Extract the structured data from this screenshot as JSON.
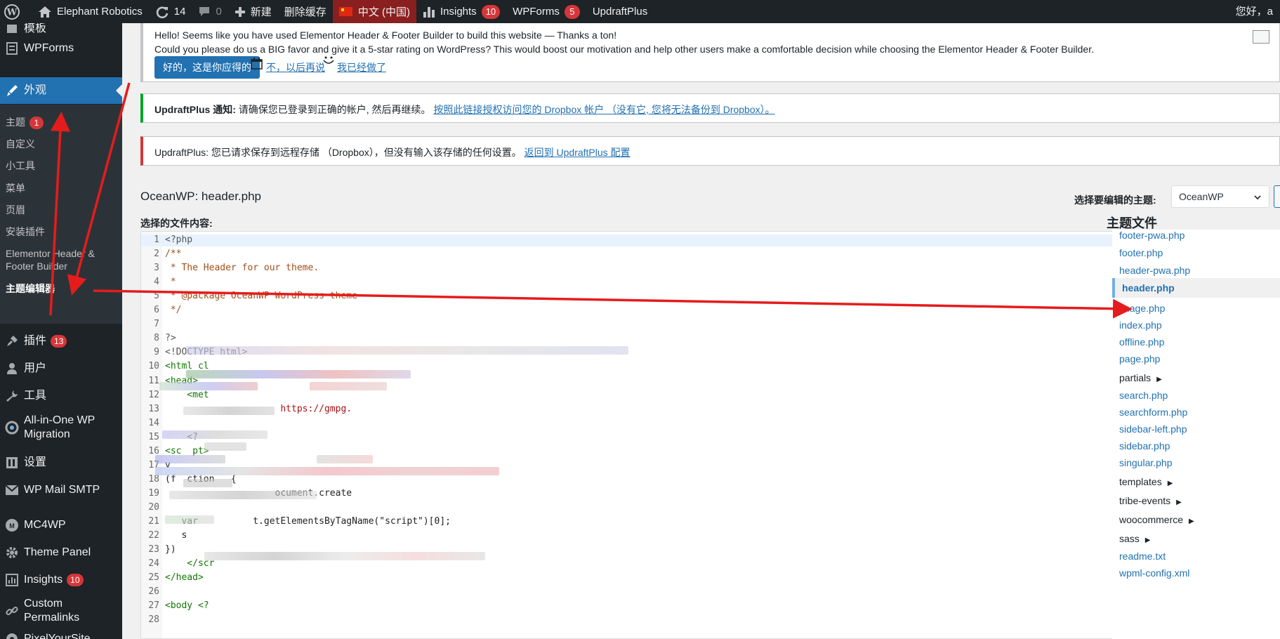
{
  "admin_bar": {
    "site_name": "Elephant Robotics",
    "updates_count": "14",
    "comments_count": "0",
    "new_label": "新建",
    "purge_cache_label": "删除缓存",
    "language_label": "中文 (中国)",
    "insights_label": "Insights",
    "insights_count": "10",
    "wpforms_label": "WPForms",
    "wpforms_count": "5",
    "updraftplus_label": "UpdraftPlus",
    "greeting": "您好，a"
  },
  "sidebar": {
    "items": [
      {
        "label": "模板",
        "icon": "templates-icon"
      },
      {
        "label": "WPForms",
        "icon": "wpforms-icon"
      },
      {
        "label": "外观",
        "icon": "appearance-icon",
        "active": true
      },
      {
        "label": "插件",
        "icon": "plugins-icon",
        "badge": "13"
      },
      {
        "label": "用户",
        "icon": "users-icon"
      },
      {
        "label": "工具",
        "icon": "tools-icon"
      },
      {
        "label": "All-in-One WP Migration",
        "icon": "migration-icon"
      },
      {
        "label": "设置",
        "icon": "settings-icon"
      },
      {
        "label": "WP Mail SMTP",
        "icon": "mail-icon"
      },
      {
        "label": "MC4WP",
        "icon": "mc4wp-icon"
      },
      {
        "label": "Theme Panel",
        "icon": "gear-icon"
      },
      {
        "label": "Insights",
        "icon": "insights-icon",
        "badge": "10"
      },
      {
        "label": "Custom Permalinks",
        "icon": "link-icon"
      },
      {
        "label": "PixelYourSite",
        "icon": "pixelyoursite-icon"
      }
    ],
    "submenu": [
      {
        "label": "主题",
        "badge": "1"
      },
      {
        "label": "自定义"
      },
      {
        "label": "小工具"
      },
      {
        "label": "菜单"
      },
      {
        "label": "页眉"
      },
      {
        "label": "安装插件"
      },
      {
        "label": "Elementor Header & Footer Builder"
      },
      {
        "label": "主题编辑器",
        "current": true
      }
    ]
  },
  "hfe_notice": {
    "line1": "Hello! Seems like you have used Elementor Header & Footer Builder to build this website — Thanks a ton!",
    "line2": "Could you please do us a BIG favor and give it a 5-star rating on WordPress? This would boost our motivation and help other users make a comfortable decision while choosing the Elementor Header & Footer Builder.",
    "rate_button": "好的，这是你应得的",
    "later_link": "不，以后再说",
    "done_link": "我已经做了"
  },
  "updraft_notice_1": {
    "label": "UpdraftPlus 通知:",
    "text": " 请确保您已登录到正确的帐户, 然后再继续。",
    "link": "按照此链接授权访问您的 Dropbox 帐户 （没有它, 您将无法备份到 Dropbox）。"
  },
  "updraft_notice_2": {
    "text": "UpdraftPlus: 您已请求保存到远程存储 （Dropbox），但没有输入该存储的任何设置。",
    "link": "返回到 UpdraftPlus 配置"
  },
  "editor": {
    "file_title": "OceanWP: header.php",
    "select_theme_label": "选择要编辑的主题:",
    "selected_theme": "OceanWP",
    "content_label": "选择的文件内容:",
    "lines": [
      {
        "n": "1",
        "text": "<?php",
        "cls": "c-meta"
      },
      {
        "n": "2",
        "text": "/**",
        "cls": "c-comment"
      },
      {
        "n": "3",
        "text": " * The Header for our theme.",
        "cls": "c-comment"
      },
      {
        "n": "4",
        "text": " *",
        "cls": "c-comment"
      },
      {
        "n": "5",
        "text": " * @package OceanWP WordPress theme",
        "cls": "c-comment"
      },
      {
        "n": "6",
        "text": " */",
        "cls": "c-comment"
      },
      {
        "n": "7",
        "text": "",
        "cls": "c-plain"
      },
      {
        "n": "8",
        "text": "?>",
        "cls": "c-meta"
      },
      {
        "n": "9",
        "text": "<!DOCTYPE html>",
        "cls": "c-meta"
      },
      {
        "n": "10",
        "text": "<html cl",
        "cls": "c-tag"
      },
      {
        "n": "11",
        "text": "<head>",
        "cls": "c-tag"
      },
      {
        "n": "12",
        "text": "    <met",
        "cls": "c-tag"
      },
      {
        "n": "13",
        "text": "                     https://gmpg.",
        "cls": "c-str"
      },
      {
        "n": "14",
        "text": "",
        "cls": "c-plain"
      },
      {
        "n": "15",
        "text": "    <?",
        "cls": "c-meta"
      },
      {
        "n": "16",
        "text": "<sc  pt>",
        "cls": "c-tag"
      },
      {
        "n": "17",
        "text": "v",
        "cls": "c-plain"
      },
      {
        "n": "18",
        "text": "(f  ction   {",
        "cls": "c-plain"
      },
      {
        "n": "19",
        "text": "                    ocument.create",
        "cls": "c-plain"
      },
      {
        "n": "20",
        "text": "",
        "cls": "c-plain"
      },
      {
        "n": "21",
        "text": "   var          t.getElementsByTagName(\"script\")[0];",
        "cls": "c-plain"
      },
      {
        "n": "22",
        "text": "   s",
        "cls": "c-plain"
      },
      {
        "n": "23",
        "text": "})",
        "cls": "c-plain"
      },
      {
        "n": "24",
        "text": "    </scr",
        "cls": "c-tag"
      },
      {
        "n": "25",
        "text": "</head>",
        "cls": "c-tag"
      },
      {
        "n": "26",
        "text": "",
        "cls": "c-plain"
      },
      {
        "n": "27",
        "text": "<body <?",
        "cls": "c-tag"
      },
      {
        "n": "28",
        "text": "",
        "cls": "c-plain"
      }
    ]
  },
  "theme_files": {
    "title": "主题文件",
    "items": [
      {
        "label": "footer-pwa.php"
      },
      {
        "label": "footer.php"
      },
      {
        "label": "header-pwa.php"
      },
      {
        "label": "header.php",
        "current": true
      },
      {
        "label": "image.php"
      },
      {
        "label": "index.php"
      },
      {
        "label": "offline.php"
      },
      {
        "label": "page.php"
      },
      {
        "label": "partials",
        "folder": true
      },
      {
        "label": "search.php"
      },
      {
        "label": "searchform.php"
      },
      {
        "label": "sidebar-left.php"
      },
      {
        "label": "sidebar.php"
      },
      {
        "label": "singular.php"
      },
      {
        "label": "templates",
        "folder": true
      },
      {
        "label": "tribe-events",
        "folder": true
      },
      {
        "label": "woocommerce",
        "folder": true
      },
      {
        "label": "sass",
        "folder": true
      },
      {
        "label": "readme.txt"
      },
      {
        "label": "wpml-config.xml"
      }
    ]
  },
  "colors": {
    "admin_bar_bg": "#1d2327",
    "accent_blue": "#2271b1",
    "badge_red": "#d63638",
    "notice_success": "#00a32a",
    "annotation_arrow": "#e51c1c"
  }
}
